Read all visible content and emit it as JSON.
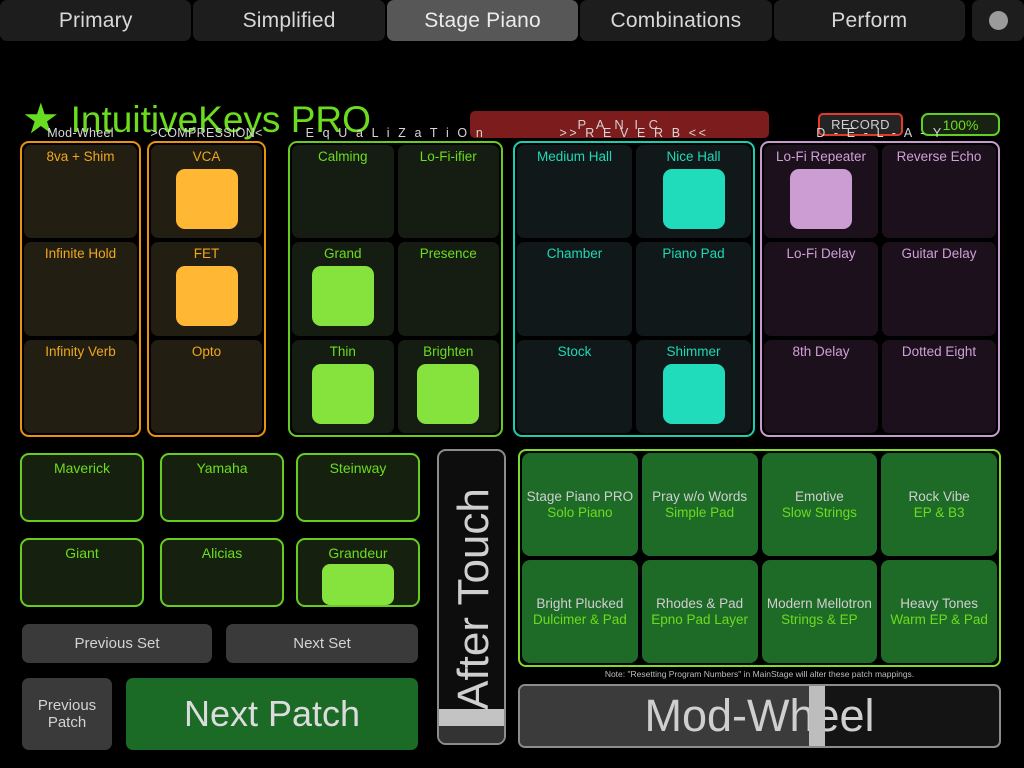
{
  "tabs": [
    {
      "label": "Primary",
      "active": false
    },
    {
      "label": "Simplified",
      "active": false
    },
    {
      "label": "Stage Piano",
      "active": true
    },
    {
      "label": "Combinations",
      "active": false
    },
    {
      "label": "Perform",
      "active": false
    }
  ],
  "header": {
    "star_glyph": "★",
    "title": "IntuitiveKeys PRO",
    "panic_label": "P A N I C",
    "record_label": "RECORD",
    "volume_label": "100%",
    "brand_color": "#6bdd1e",
    "panic_color": "#7d1c1c",
    "record_border_color": "#e23b2a"
  },
  "sections": [
    {
      "key": "modwheel",
      "label": "Mod-Wheel",
      "accent": "#e8920f",
      "columns": [
        [
          {
            "label": "8va + Shim",
            "lit": false
          },
          {
            "label": "Infinite Hold",
            "lit": false
          },
          {
            "label": "Infinity Verb",
            "lit": false
          }
        ]
      ]
    },
    {
      "key": "compression",
      "label": ">COMPRESSION<",
      "accent": "#e8920f",
      "columns": [
        [
          {
            "label": "VCA",
            "lit": true
          },
          {
            "label": "FET",
            "lit": true
          },
          {
            "label": "Opto",
            "lit": false
          }
        ]
      ]
    },
    {
      "key": "equalization",
      "label": "E q U a L i Z a T i O n",
      "accent": "#66cc22",
      "columns": [
        [
          {
            "label": "Calming",
            "lit": false
          },
          {
            "label": "Grand",
            "lit": true
          },
          {
            "label": "Thin",
            "lit": true
          }
        ],
        [
          {
            "label": "Lo-Fi-ifier",
            "lit": false
          },
          {
            "label": "Presence",
            "lit": false
          },
          {
            "label": "Brighten",
            "lit": true
          }
        ]
      ]
    },
    {
      "key": "reverb",
      "label": ">> R E V E R B <<",
      "accent": "#17cfb0",
      "columns": [
        [
          {
            "label": "Medium Hall",
            "lit": false
          },
          {
            "label": "Chamber",
            "lit": false
          },
          {
            "label": "Stock",
            "lit": false
          }
        ],
        [
          {
            "label": "Nice Hall",
            "lit": true
          },
          {
            "label": "Piano Pad",
            "lit": false
          },
          {
            "label": "Shimmer",
            "lit": true
          }
        ]
      ]
    },
    {
      "key": "delay",
      "label": "D - E - L - A - Y",
      "accent": "#c79bcd",
      "columns": [
        [
          {
            "label": "Lo-Fi Repeater",
            "lit": true
          },
          {
            "label": "Lo-Fi Delay",
            "lit": false
          },
          {
            "label": "8th Delay",
            "lit": false
          }
        ],
        [
          {
            "label": "Reverse Echo",
            "lit": false
          },
          {
            "label": "Guitar Delay",
            "lit": false
          },
          {
            "label": "Dotted Eight",
            "lit": false
          }
        ]
      ]
    }
  ],
  "pianos": [
    {
      "label": "Maverick",
      "lit": false
    },
    {
      "label": "Yamaha",
      "lit": false
    },
    {
      "label": "Steinway",
      "lit": false
    },
    {
      "label": "Giant",
      "lit": false
    },
    {
      "label": "Alicias",
      "lit": false
    },
    {
      "label": "Grandeur",
      "lit": true
    }
  ],
  "nav": {
    "previous_set": "Previous Set",
    "next_set": "Next Set",
    "previous_patch": "Previous\nPatch",
    "next_patch": "Next Patch"
  },
  "after_touch": {
    "label": "After Touch",
    "value_percent": 6
  },
  "mod_wheel_slider": {
    "label": "Mod-Wheel",
    "value_percent": 62
  },
  "patches": {
    "rows": [
      [
        {
          "name": "Stage Piano PRO",
          "sub": "Solo Piano"
        },
        {
          "name": "Pray w/o Words",
          "sub": "Simple Pad"
        },
        {
          "name": "Emotive",
          "sub": "Slow Strings"
        },
        {
          "name": "Rock Vibe",
          "sub": "EP & B3"
        }
      ],
      [
        {
          "name": "Bright Plucked",
          "sub": "Dulcimer & Pad"
        },
        {
          "name": "Rhodes & Pad",
          "sub": "Epno Pad Layer"
        },
        {
          "name": "Modern  Mellotron",
          "sub": "Strings & EP"
        },
        {
          "name": "Heavy Tones",
          "sub": "Warm EP & Pad"
        }
      ]
    ],
    "note": "Note: \"Resetting Program Numbers\" in MainStage will alter these patch mappings."
  }
}
